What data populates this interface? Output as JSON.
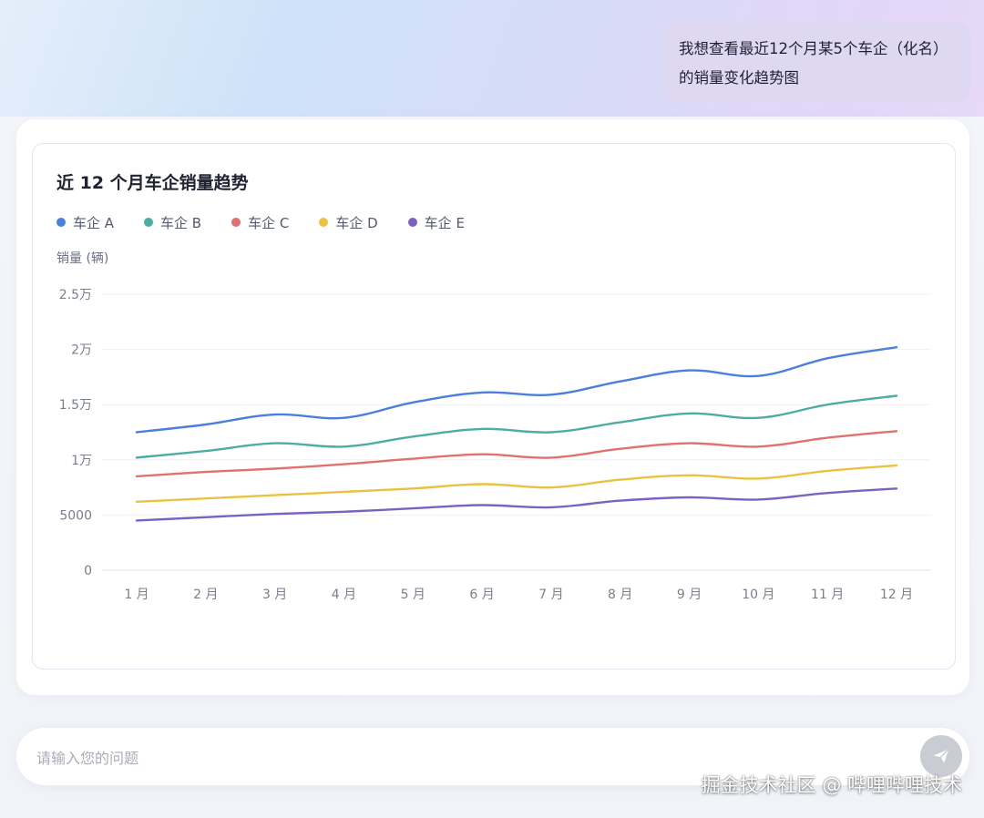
{
  "user_message": "我想查看最近12个月某5个车企（化名）的销量变化趋势图",
  "input": {
    "placeholder": "请输入您的问题",
    "value": ""
  },
  "watermark": "掘金技术社区 @ 哔哩哔哩技术",
  "chart_data": {
    "type": "line",
    "title": "近 12 个月车企销量趋势",
    "ylabel": "销量 (辆)",
    "xlabel": "",
    "smooth": true,
    "ylim": [
      0,
      25000
    ],
    "yticks": [
      0,
      5000,
      10000,
      15000,
      20000,
      25000
    ],
    "ytick_labels": [
      "0",
      "5000",
      "1万",
      "1.5万",
      "2万",
      "2.5万"
    ],
    "categories": [
      "1 月",
      "2 月",
      "3 月",
      "4 月",
      "5 月",
      "6 月",
      "7 月",
      "8 月",
      "9 月",
      "10 月",
      "11 月",
      "12 月"
    ],
    "legend_position": "top-left",
    "grid": true,
    "series": [
      {
        "name": "车企 A",
        "color": "#4a7fdb",
        "values": [
          12500,
          13200,
          14100,
          13800,
          15200,
          16100,
          15900,
          17100,
          18100,
          17600,
          19200,
          20200
        ]
      },
      {
        "name": "车企 B",
        "color": "#4eada3",
        "values": [
          10200,
          10800,
          11500,
          11200,
          12100,
          12800,
          12500,
          13400,
          14200,
          13800,
          15000,
          15800
        ]
      },
      {
        "name": "车企 C",
        "color": "#e0716f",
        "values": [
          8500,
          8900,
          9200,
          9600,
          10100,
          10500,
          10200,
          11000,
          11500,
          11200,
          12000,
          12600
        ]
      },
      {
        "name": "车企 D",
        "color": "#ebc23f",
        "values": [
          6200,
          6500,
          6800,
          7100,
          7400,
          7800,
          7500,
          8200,
          8600,
          8300,
          9000,
          9500
        ]
      },
      {
        "name": "车企 E",
        "color": "#7b62c2",
        "values": [
          4500,
          4800,
          5100,
          5300,
          5600,
          5900,
          5700,
          6300,
          6600,
          6400,
          7000,
          7400
        ]
      }
    ]
  }
}
